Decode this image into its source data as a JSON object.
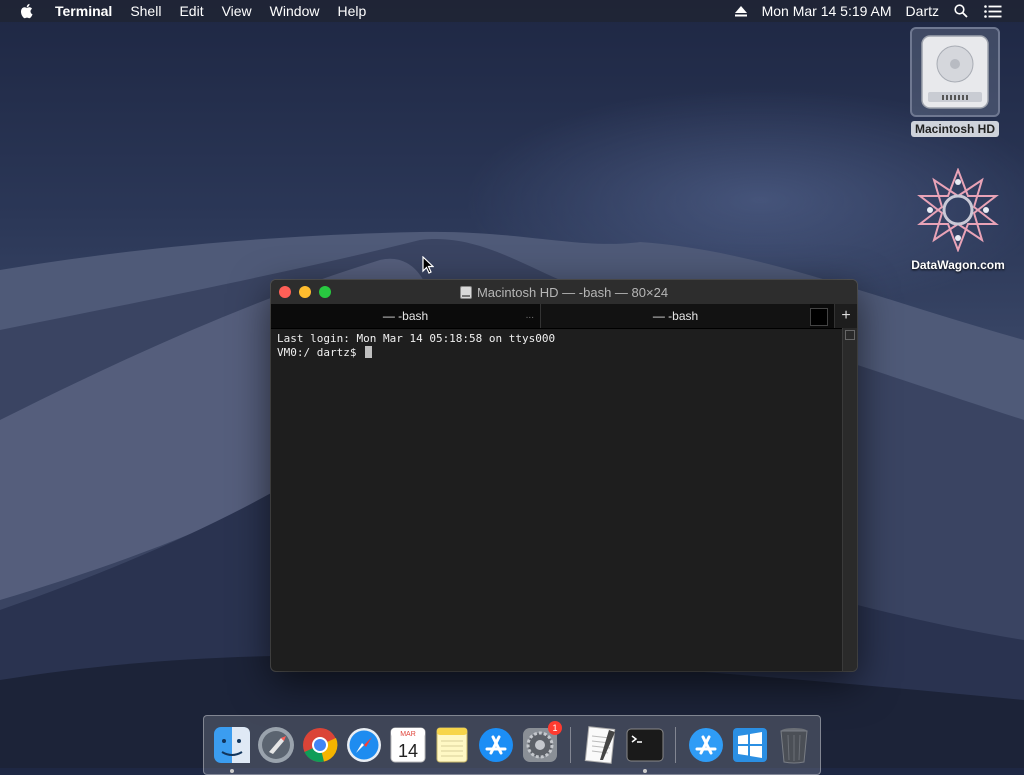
{
  "menubar": {
    "app_name": "Terminal",
    "menus": [
      "Shell",
      "Edit",
      "View",
      "Window",
      "Help"
    ],
    "datetime": "Mon Mar 14  5:19 AM",
    "user": "Dartz"
  },
  "desktop": {
    "icons": [
      {
        "label": "Macintosh HD",
        "icon": "hard-drive-icon"
      },
      {
        "label": "DataWagon.com",
        "icon": "datawagon-logo-icon"
      }
    ]
  },
  "terminal": {
    "title": "Macintosh HD — -bash — 80×24",
    "tabs": [
      {
        "label": "— -bash",
        "extra": "..."
      },
      {
        "label": "— -bash"
      }
    ],
    "lines": [
      "Last login: Mon Mar 14 05:18:58 on ttys000",
      "VM0:/ dartz$"
    ]
  },
  "dock": {
    "items": [
      {
        "name": "finder-icon"
      },
      {
        "name": "launchpad-icon"
      },
      {
        "name": "chrome-icon"
      },
      {
        "name": "safari-icon"
      },
      {
        "name": "calendar-icon",
        "month": "MAR",
        "day": "14"
      },
      {
        "name": "notes-icon"
      },
      {
        "name": "app-store-icon"
      },
      {
        "name": "system-preferences-icon",
        "badge": "1"
      },
      {
        "name": "textedit-icon"
      },
      {
        "name": "terminal-icon"
      },
      {
        "name": "app-store-downloads-icon"
      },
      {
        "name": "windows-icon"
      },
      {
        "name": "trash-icon"
      }
    ]
  }
}
